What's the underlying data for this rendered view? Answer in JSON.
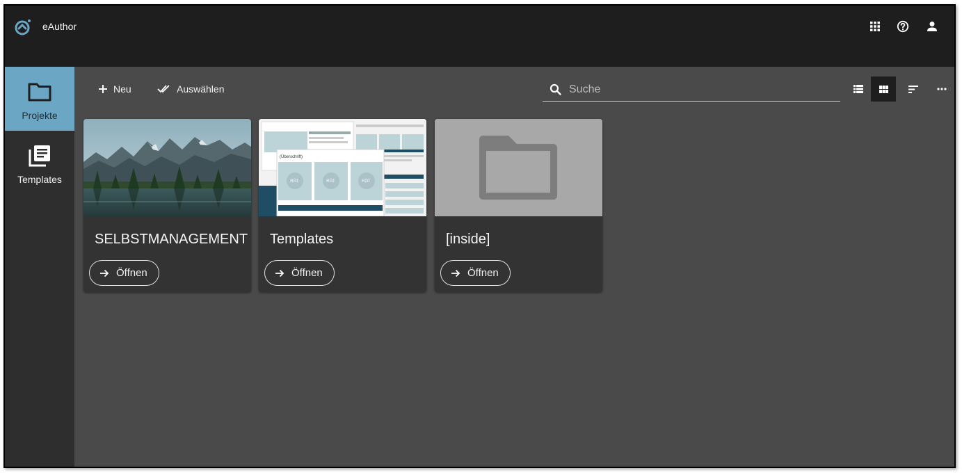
{
  "app": {
    "title": "eAuthor"
  },
  "topbar": {
    "icons": [
      "apps-grid-icon",
      "help-icon",
      "account-icon"
    ]
  },
  "sidebar": {
    "items": [
      {
        "label": "Projekte",
        "icon": "folder-icon",
        "active": true
      },
      {
        "label": "Templates",
        "icon": "library-books-icon",
        "active": false
      }
    ]
  },
  "toolbar": {
    "new_label": "Neu",
    "select_label": "Auswählen"
  },
  "search": {
    "placeholder": "Suche",
    "value": ""
  },
  "view": {
    "active": "grid"
  },
  "cards": [
    {
      "title": "SELBSTMANAGEMENT",
      "open_label": "Öffnen",
      "thumb": "mountain-lake-photo"
    },
    {
      "title": "Templates",
      "open_label": "Öffnen",
      "thumb": "template-layout-preview"
    },
    {
      "title": "[inside]",
      "open_label": "Öffnen",
      "thumb": "folder-placeholder"
    }
  ],
  "template_preview": {
    "heading": "(Überschrift)",
    "image_label": "Bild"
  },
  "colors": {
    "appbar": "#1e1e1e",
    "sidebar": "#2e2e2e",
    "content": "#4a4a4a",
    "accent": "#6ba7c4",
    "card": "#333333"
  }
}
